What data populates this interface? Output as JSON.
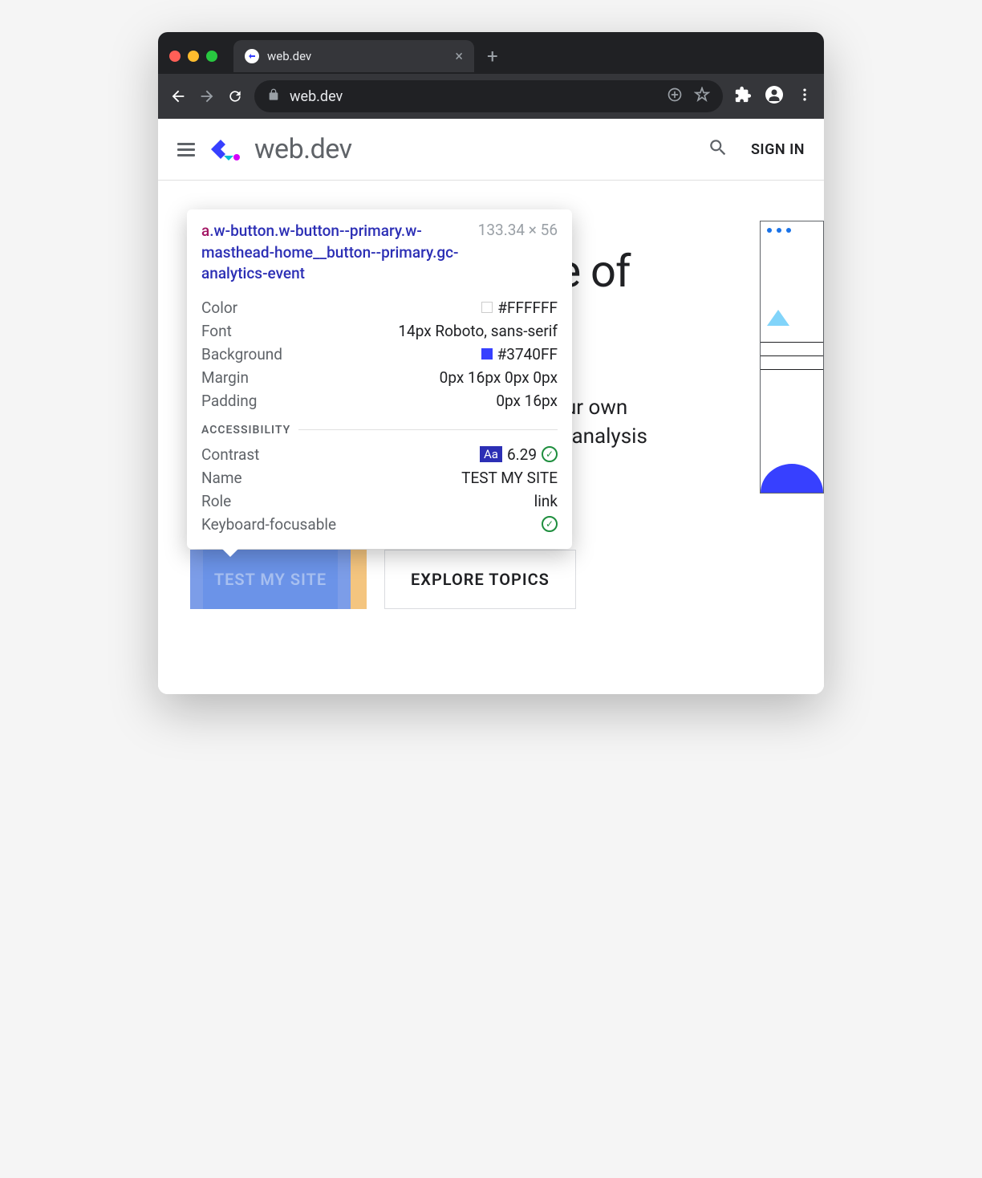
{
  "browser": {
    "tab_title": "web.dev",
    "url": "web.dev",
    "new_tab_icon": "+",
    "close_tab_icon": "×"
  },
  "site_header": {
    "site_name": "web.dev",
    "signin_label": "SIGN IN"
  },
  "hero": {
    "title_fragment": "re of",
    "line1_fragment": "your own",
    "line2_fragment": "nd analysis",
    "primary_button": "TEST MY SITE",
    "secondary_button": "EXPLORE TOPICS"
  },
  "tooltip": {
    "element_tag": "a",
    "element_classes": ".w-button.w-button--primary.w-masthead-home__button--primary.gc-analytics-event",
    "dimensions": "133.34 × 56",
    "styles": {
      "color_label": "Color",
      "color_value": "#FFFFFF",
      "font_label": "Font",
      "font_value": "14px Roboto, sans-serif",
      "background_label": "Background",
      "background_value": "#3740FF",
      "margin_label": "Margin",
      "margin_value": "0px 16px 0px 0px",
      "padding_label": "Padding",
      "padding_value": "0px 16px"
    },
    "a11y_section": "ACCESSIBILITY",
    "a11y": {
      "contrast_label": "Contrast",
      "contrast_badge": "Aa",
      "contrast_value": "6.29",
      "name_label": "Name",
      "name_value": "TEST MY SITE",
      "role_label": "Role",
      "role_value": "link",
      "focusable_label": "Keyboard-focusable"
    }
  }
}
